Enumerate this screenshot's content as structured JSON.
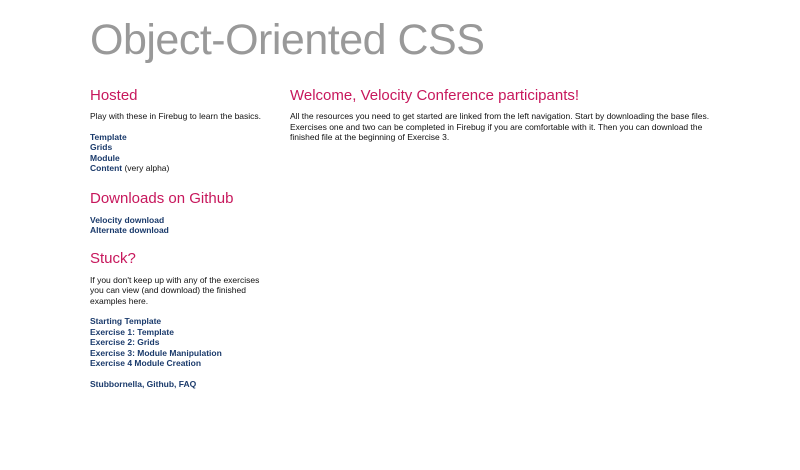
{
  "site": {
    "title": "Object-Oriented CSS"
  },
  "sidebar": {
    "hosted": {
      "heading": "Hosted",
      "intro": "Play with these in Firebug to learn the basics.",
      "links": [
        {
          "label": "Template"
        },
        {
          "label": "Grids"
        },
        {
          "label": "Module"
        },
        {
          "label": "Content",
          "note": " (very alpha)"
        }
      ]
    },
    "downloads": {
      "heading": "Downloads on Github",
      "links": [
        {
          "label": "Velocity download"
        },
        {
          "label": "Alternate download"
        }
      ]
    },
    "stuck": {
      "heading": "Stuck?",
      "intro": "If you don't keep up with any of the exercises you can view (and download) the finished examples here.",
      "links": [
        {
          "label": "Starting Template"
        },
        {
          "label": "Exercise 1: Template"
        },
        {
          "label": "Exercise 2: Grids"
        },
        {
          "label": "Exercise 3: Module Manipulation"
        },
        {
          "label": "Exercise 4 Module Creation"
        }
      ]
    },
    "misc": {
      "links": [
        {
          "label": "Stubbornella, Github, FAQ"
        }
      ]
    }
  },
  "main": {
    "heading": "Welcome, Velocity Conference participants!",
    "body": "All the resources you need to get started are linked from the left navigation. Start by downloading the base files. Exercises one and two can be completed in Firebug if you are comfortable with it. Then you can download the finished file at the beginning of Exercise 3."
  },
  "colors": {
    "title": "#999999",
    "heading": "#c7175c",
    "link": "#1a3a6b",
    "text": "#111111",
    "background": "#ffffff"
  }
}
